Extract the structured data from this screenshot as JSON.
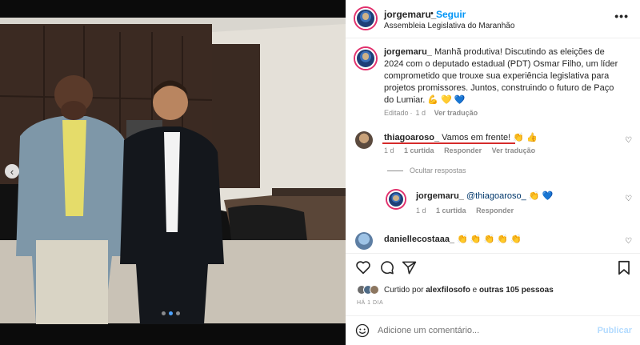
{
  "post": {
    "username": "jorgemaru_",
    "dot": "•",
    "follow_label": "Seguir",
    "location": "Assembleia Legislativa do Maranhão",
    "more_label": "•••"
  },
  "caption": {
    "username": "jorgemaru_",
    "text": "Manhã produtiva! Discutindo as eleições de 2024 com o deputado estadual (PDT) Osmar Filho, um líder comprometido que trouxe sua experiência legislativa para projetos promissores. Juntos, construindo o futuro de Paço do Lumiar. 💪 💛 💙",
    "edited": "Editado",
    "time": "1 d",
    "translate": "Ver tradução"
  },
  "comments": [
    {
      "username": "thiagoaroso_",
      "text": "Vamos em frente! 👏 👍",
      "time": "1 d",
      "likes": "1 curtida",
      "reply": "Responder",
      "translate": "Ver tradução"
    },
    {
      "username": "jorgemaru_",
      "text": "@thiagoaroso_ 👏 💙",
      "time": "1 d",
      "likes": "1 curtida",
      "reply": "Responder"
    },
    {
      "username": "daniellecostaaa_",
      "text": "👏 👏 👏 👏 👏"
    }
  ],
  "hide_replies": "Ocultar respostas",
  "likes": {
    "prefix": "Curtido por",
    "user": "alexfilosofo",
    "middle": "e",
    "others": "outras 105 pessoas"
  },
  "time_ago": "HÁ 1 DIA",
  "add_comment": {
    "placeholder": "Adicione um comentário...",
    "publish": "Publicar"
  },
  "carousel": {
    "total": 3,
    "active": 2
  },
  "colors": {
    "accent": "#0095f6",
    "story_ring": "#e1306c",
    "annotation": "#d62b2b"
  }
}
